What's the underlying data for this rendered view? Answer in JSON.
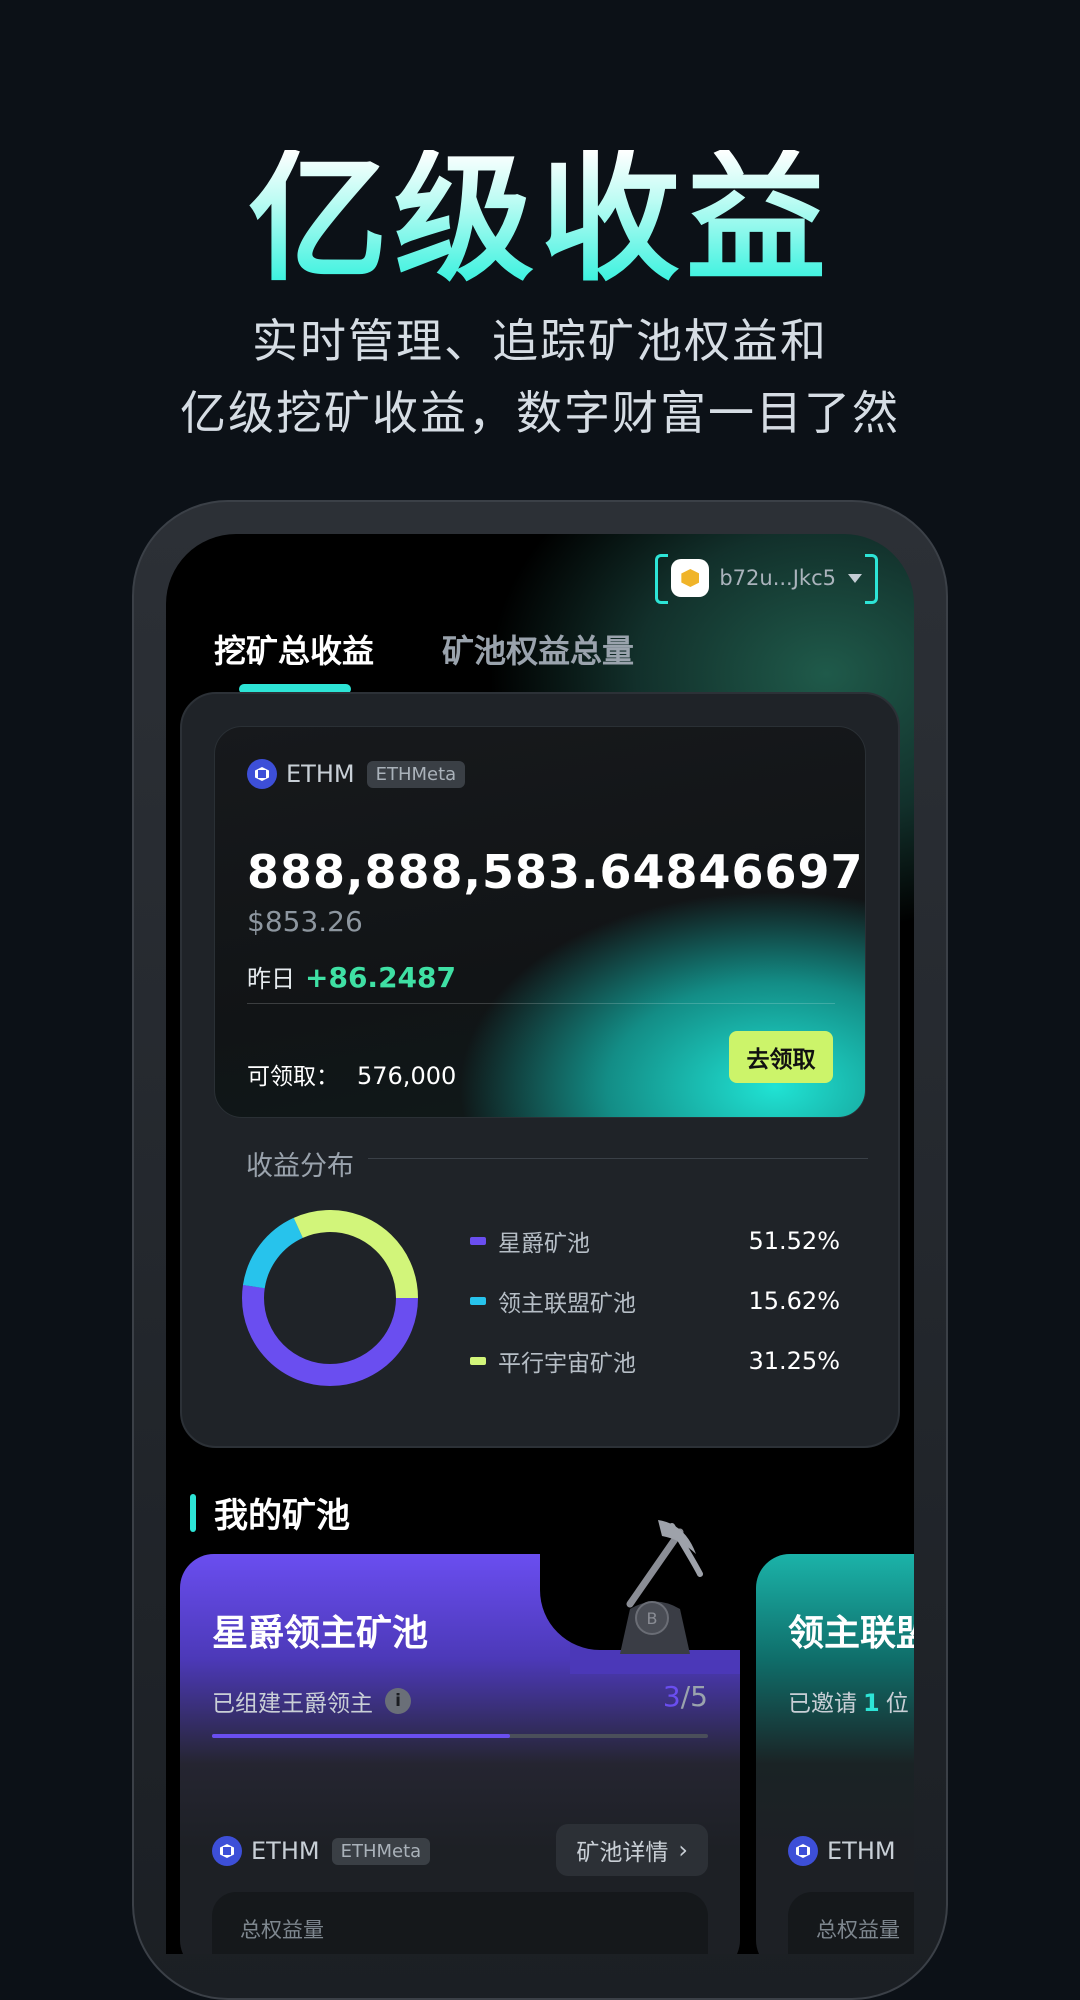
{
  "hero": {
    "title": "亿级收益",
    "subtitle_line1": "实时管理、追踪矿池权益和",
    "subtitle_line2": "亿级挖矿收益，数字财富一目了然"
  },
  "wallet": {
    "address": "b72u...Jkc5",
    "icon": "wallet-avatar-icon"
  },
  "tabs": [
    {
      "label": "挖矿总收益",
      "active": true
    },
    {
      "label": "矿池权益总量",
      "active": false
    }
  ],
  "earnings_card": {
    "token_symbol": "ETHM",
    "token_tag": "ETHMeta",
    "total": "888,888,583.64846697",
    "usd_value": "$853.26",
    "yesterday_label": "昨日",
    "yesterday_change": "+86.2487",
    "claimable_label": "可领取：",
    "claimable_value": "576,000",
    "claim_button": "去领取"
  },
  "distribution": {
    "title": "收益分布",
    "items": [
      {
        "name": "星爵矿池",
        "percent": "51.52%",
        "value": 51.52,
        "color": "#6a4ef0"
      },
      {
        "name": "领主联盟矿池",
        "percent": "15.62%",
        "value": 15.62,
        "color": "#27c3ec"
      },
      {
        "name": "平行宇宙矿池",
        "percent": "31.25%",
        "value": 31.25,
        "color": "#d2f57a"
      }
    ]
  },
  "my_pools": {
    "title": "我的矿池",
    "pools": [
      {
        "name": "星爵领主矿池",
        "sub_label": "已组建王爵领主",
        "count_current": "3",
        "count_total": "/5",
        "progress_fraction": 0.6,
        "token_symbol": "ETHM",
        "token_tag": "ETHMeta",
        "detail_button": "矿池详情",
        "inner_label": "总权益量"
      },
      {
        "name": "领主联盟矿池",
        "sub_prefix": "已邀请",
        "sub_count": "1",
        "sub_suffix": "位",
        "token_symbol": "ETHM",
        "inner_label": "总权益量"
      }
    ]
  }
}
